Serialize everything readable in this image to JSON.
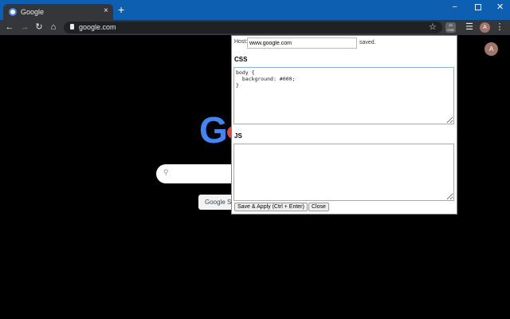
{
  "browser": {
    "tab_title": "Google",
    "url": "google.com",
    "ext_label": "JS CSS",
    "profile_initial": "A"
  },
  "page": {
    "search_button": "Google Search",
    "avatar_initial": "A",
    "logo_letter": "G"
  },
  "popup": {
    "host_label": "Host:",
    "host_value": "www.google.com",
    "status": "saved.",
    "css_label": "CSS",
    "css_value": "body {\n  background: #000;\n}",
    "js_label": "JS",
    "js_value": "",
    "save_button": "Save & Apply (Ctrl + Enter)",
    "close_button": "Close"
  }
}
